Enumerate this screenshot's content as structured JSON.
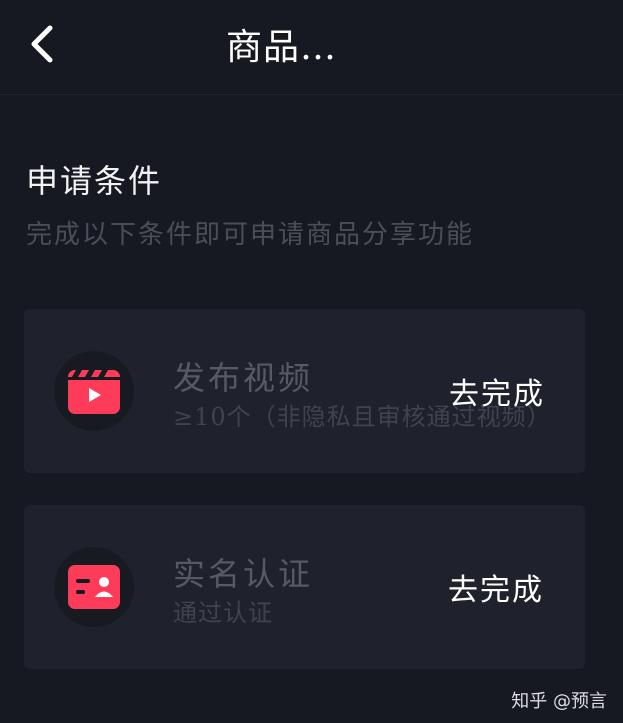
{
  "header": {
    "title": "商品…"
  },
  "conditions": {
    "title": "申请条件",
    "subtitle": "完成以下条件即可申请商品分享功能",
    "items": [
      {
        "title": "发布视频",
        "description": "≥10个（非隐私且审核通过视频）",
        "action_label": "去完成",
        "icon": "video-clapper-icon"
      },
      {
        "title": "实名认证",
        "description": "通过认证",
        "action_label": "去完成",
        "icon": "id-card-icon"
      }
    ]
  },
  "watermark": "知乎 @预言",
  "colors": {
    "background": "#171922",
    "card": "#1f222d",
    "accent": "#fe3c5a"
  }
}
